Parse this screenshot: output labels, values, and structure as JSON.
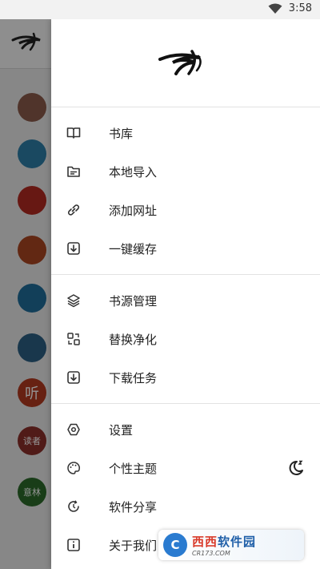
{
  "status_bar": {
    "time": "3:58",
    "wifi_icon": "wifi-icon"
  },
  "background_app": {
    "avatars": [
      {
        "name": "source-avatar-1",
        "color": "#8a5a4a"
      },
      {
        "name": "source-avatar-2",
        "color": "#2e7fa8"
      },
      {
        "name": "source-avatar-3",
        "color": "#b22a21"
      },
      {
        "name": "source-avatar-4",
        "color": "#a94521"
      },
      {
        "name": "source-avatar-5",
        "color": "#1f6d9a"
      },
      {
        "name": "source-avatar-6",
        "color": "#2c5f83"
      },
      {
        "name": "source-avatar-7",
        "color": "#b23a20"
      },
      {
        "name": "source-avatar-8",
        "color": "#8b2f2a",
        "text": "读者"
      },
      {
        "name": "source-avatar-9",
        "color": "#2b6a2a",
        "text": "意林"
      }
    ],
    "listen_glyph": "听"
  },
  "drawer": {
    "sections": [
      [
        {
          "name": "bookshelf",
          "label": "书库",
          "icon": "book-icon"
        },
        {
          "name": "local-import",
          "label": "本地导入",
          "icon": "folder-icon"
        },
        {
          "name": "add-url",
          "label": "添加网址",
          "icon": "link-icon"
        },
        {
          "name": "one-click-cache",
          "label": "一键缓存",
          "icon": "download-icon"
        }
      ],
      [
        {
          "name": "source-management",
          "label": "书源管理",
          "icon": "layers-icon"
        },
        {
          "name": "replace-purify",
          "label": "替换净化",
          "icon": "replace-icon"
        },
        {
          "name": "download-tasks",
          "label": "下载任务",
          "icon": "download-task-icon"
        }
      ],
      [
        {
          "name": "settings",
          "label": "设置",
          "icon": "settings-icon"
        },
        {
          "name": "theme",
          "label": "个性主题",
          "icon": "palette-icon",
          "trailing_icon": "night-mode-icon"
        },
        {
          "name": "share-app",
          "label": "软件分享",
          "icon": "share-icon"
        },
        {
          "name": "about-us",
          "label": "关于我们",
          "icon": "info-icon"
        }
      ]
    ]
  },
  "watermark": {
    "main_a": "西西",
    "main_b": "软件园",
    "sub": "CR173.COM",
    "badge": "C"
  }
}
